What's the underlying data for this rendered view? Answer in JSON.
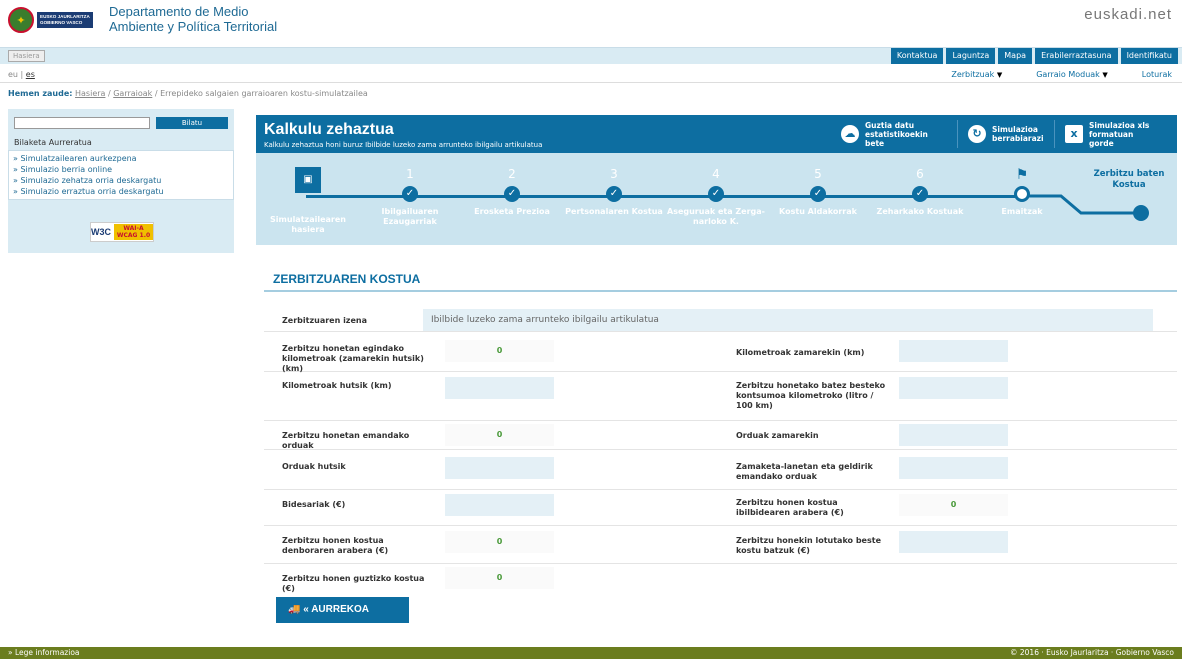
{
  "header": {
    "gv_badge": "EUSKO JAURLARITZA\nGOBIERNO VASCO",
    "dept_title": "Departamento de Medio Ambiente y Política Territorial",
    "euskadi_logo": "euskadi.net"
  },
  "navbar": {
    "hasiera": "Hasiera",
    "links": [
      "Kontaktua",
      "Laguntza",
      "Mapa",
      "Erabilerraztasuna",
      "Identifikatu"
    ]
  },
  "langbar": {
    "eu": "eu",
    "es": "es",
    "menu": [
      "Zerbitzuak",
      "Garraio Moduak",
      "Loturak"
    ]
  },
  "breadcrumb": {
    "label": "Hemen zaude:",
    "items": [
      "Hasiera",
      "Garraioak",
      "Errepideko salgaien garraioaren kostu-simulatzailea"
    ]
  },
  "sidebar": {
    "search_value": "",
    "search_button": "Bilatu",
    "advanced": "Bilaketa Aurreratua",
    "links": [
      "Simulatzailearen aurkezpena",
      "Simulazio berria online",
      "Simulazio zehatza orria deskargatu",
      "Simulazio erraztua orria deskargatu"
    ],
    "wai_label": "WAI-A WCAG 1.0"
  },
  "panel": {
    "title": "Kalkulu zehaztua",
    "subtitle": "Kalkulu zehaztua honi buruz Ibilbide luzeko zama arrunteko ibilgailu artikulatua",
    "actions": [
      "Guztia datu estatistikoekin bete",
      "Simulazioa berrabiarazi",
      "Simulazioa xls formatuan gorde"
    ]
  },
  "steps": {
    "items": [
      {
        "num": "",
        "label": "Simulatzailearen hasiera"
      },
      {
        "num": "1",
        "label": "Ibilgailuaren Ezaugarriak"
      },
      {
        "num": "2",
        "label": "Erosketa Prezioa"
      },
      {
        "num": "3",
        "label": "Pertsonalaren Kostua"
      },
      {
        "num": "4",
        "label": "Aseguruak eta Zerga-narloko K."
      },
      {
        "num": "5",
        "label": "Kostu Aldakorrak"
      },
      {
        "num": "6",
        "label": "Zeharkako Kostuak"
      },
      {
        "num": "",
        "label": "Emaitzak"
      }
    ],
    "final": "Zerbitzu baten Kostua"
  },
  "section": {
    "title": "ZERBITZUAREN KOSTUA",
    "name_label": "Zerbitzuaren izena",
    "name_value": "Ibilbide luzeko zama arrunteko ibilgailu artikulatua",
    "left": [
      {
        "label": "Zerbitzu honetan egindako kilometroak (zamarekin hutsik) (km)",
        "value": "0"
      },
      {
        "label": "Kilometroak hutsik (km)",
        "value": ""
      },
      {
        "label": "Zerbitzu honetan emandako orduak",
        "value": "0"
      },
      {
        "label": "Orduak hutsik",
        "value": ""
      },
      {
        "label": "Bidesariak (€)",
        "value": ""
      },
      {
        "label": "Zerbitzu honen kostua denboraren arabera (€)",
        "value": "0"
      },
      {
        "label": "Zerbitzu honen guztizko kostua (€)",
        "value": "0"
      }
    ],
    "right": [
      {
        "label": "Kilometroak zamarekin (km)",
        "value": ""
      },
      {
        "label": "Zerbitzu honetako batez besteko kontsumoa kilometroko (litro / 100 km)",
        "value": ""
      },
      {
        "label": "Orduak zamarekin",
        "value": ""
      },
      {
        "label": "Zamaketa-lanetan eta geldirik emandako orduak",
        "value": ""
      },
      {
        "label": "Zerbitzu honen kostua ibilbidearen arabera (€)",
        "value": "0"
      },
      {
        "label": "Zerbitzu honekin lotutako beste kostu batzuk (€)",
        "value": ""
      }
    ],
    "back_button": "« AURREKOA"
  },
  "footer": {
    "left": "» Lege informazioa",
    "right": "© 2016 · Eusko Jaurlaritza · Gobierno Vasco"
  }
}
